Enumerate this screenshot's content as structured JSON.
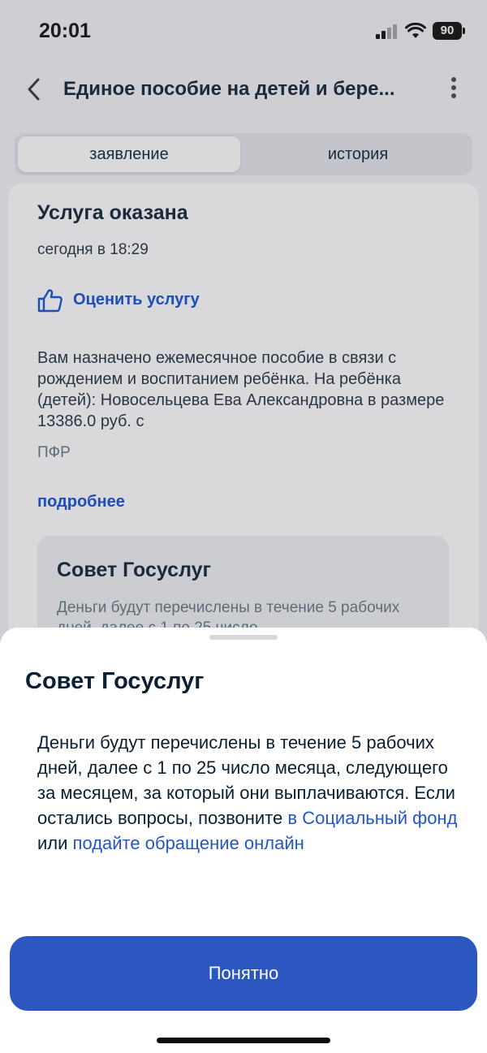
{
  "status_bar": {
    "time": "20:01",
    "battery": "90"
  },
  "nav": {
    "title": "Единое пособие на детей и бере..."
  },
  "tabs": [
    {
      "label": "заявление"
    },
    {
      "label": "история"
    }
  ],
  "card": {
    "status_title": "Услуга оказана",
    "status_time": "сегодня в 18:29",
    "rate_label": "Оценить услугу",
    "message": "Вам назначено ежемесячное пособие в связи с рождением и воспитанием ребёнка. На ребёнка (детей): Новосельцева Ева Александровна в размере 13386.0 руб. с",
    "source": "ПФР",
    "more_link": "подробнее",
    "tip_title": "Совет Госуслуг",
    "tip_text": "Деньги будут перечислены в течение 5 рабочих дней, далее с 1 по 25 число"
  },
  "sheet": {
    "title": "Совет Госуслуг",
    "text_part1": "Деньги будут перечислены в течение 5 рабочих дней, далее с 1 по 25 число месяца, следующего за месяцем, за который они выплачиваются. Если остались вопросы, позвоните ",
    "link1": "в Социальный фонд",
    "text_part2": " или ",
    "link2": "подайте обращение онлайн",
    "button_label": "Понятно"
  },
  "colors": {
    "accent": "#2c57c1",
    "link": "#0d4cd3"
  }
}
